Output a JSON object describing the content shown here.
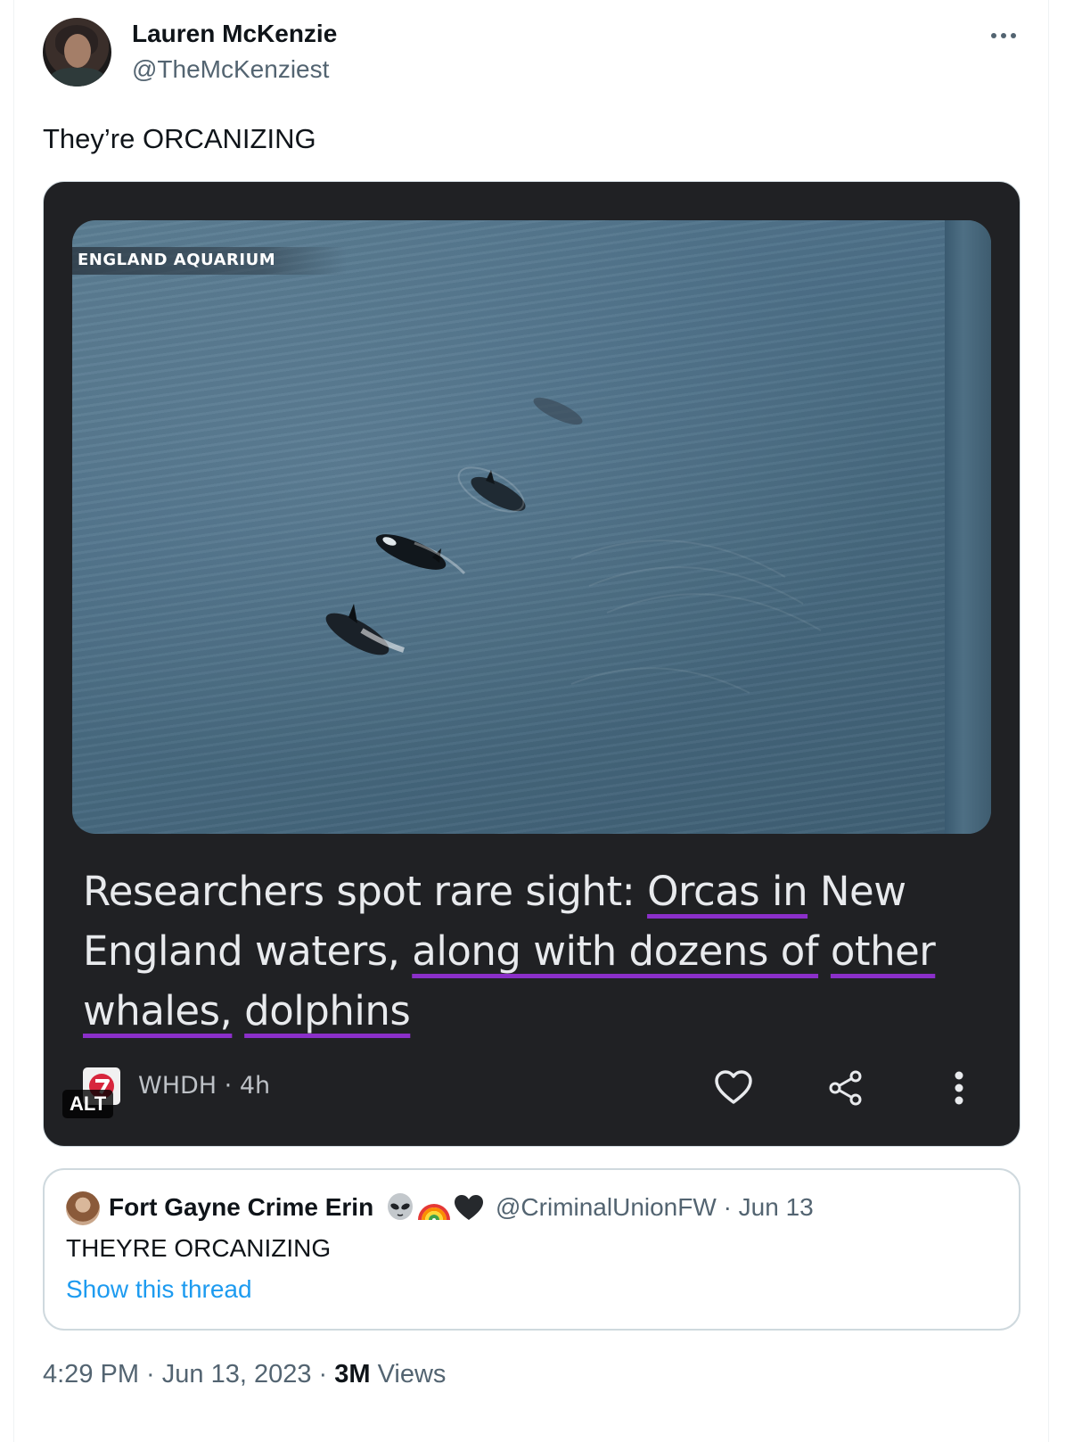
{
  "tweet": {
    "author": {
      "name": "Lauren McKenzie",
      "handle": "@TheMcKenziest"
    },
    "text": "They’re ORCANIZING",
    "more_icon": "more-horizontal-icon"
  },
  "media": {
    "watermark": "ENGLAND AQUARIUM",
    "headline": {
      "part1": "Researchers spot rare sight: ",
      "part2": "Orcas in",
      "part3": " New England waters, ",
      "part4": "along with dozens of",
      "part5": " ",
      "part6": "other whales,",
      "part7": " ",
      "part8": "dolphins"
    },
    "underline_color": "#8b2fc9",
    "source_line": "WHDH · 4h",
    "alt_badge": "ALT",
    "actions": [
      "heart-icon",
      "share-icon",
      "more-vertical-icon"
    ]
  },
  "quote": {
    "name": "Fort Gayne Crime Erin",
    "emoji": [
      "alien-icon",
      "rainbow-icon",
      "black-heart-icon"
    ],
    "handle_date": "@CriminalUnionFW · Jun 13",
    "text": "THEYRE ORCANIZING",
    "show_thread": "Show this thread"
  },
  "meta": {
    "time_date": "4:29 PM · Jun 13, 2023 · ",
    "views_count": "3M",
    "views_label": " Views"
  },
  "colors": {
    "link": "#1d9bf0",
    "secondary_text": "#536471",
    "card_bg": "#202124"
  }
}
